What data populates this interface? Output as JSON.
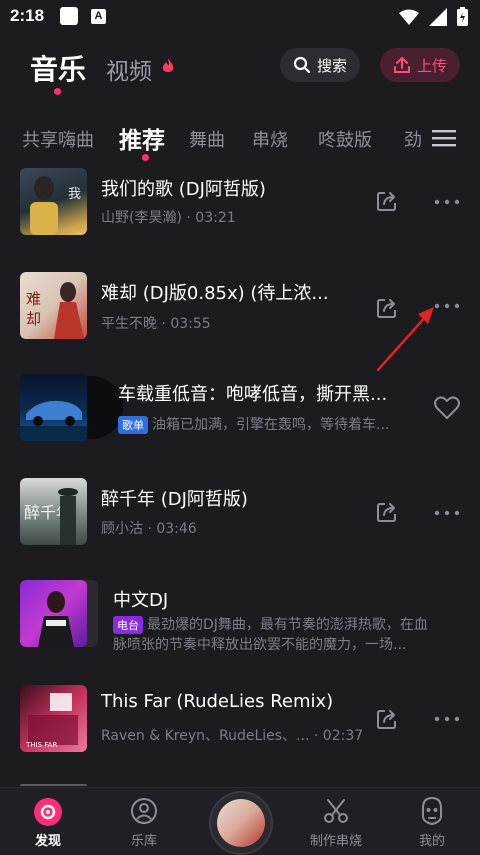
{
  "status": {
    "time": "2:18"
  },
  "header": {
    "tab_music": "音乐",
    "tab_video": "视频",
    "search_label": "搜索",
    "upload_label": "上传"
  },
  "categories": [
    "共享嗨曲",
    "推荐",
    "舞曲",
    "串烧",
    "咚鼓版",
    "劲"
  ],
  "songs": [
    {
      "title": "我们的歌 (DJ阿哲版)",
      "artist": "山野(李昊瀚)",
      "duration": "03:21"
    },
    {
      "title": "难却 (DJ版0.85x) (待上浓...",
      "artist": "平生不晚",
      "duration": "03:55"
    },
    {
      "title": "车载重低音：咆哮低音，撕开黑...",
      "badge": "歌单",
      "desc": "油箱已加满，引擎在轰鸣，等待着车..."
    },
    {
      "title": "醉千年 (DJ阿哲版)",
      "artist": "顾小沽",
      "duration": "03:46"
    },
    {
      "title": "中文DJ",
      "badge": "电台",
      "desc1": "最劲爆的DJ舞曲，最有节奏的澎湃热歌，在血",
      "desc2": "脉喷张的节奏中释放出欲罢不能的魔力，一场..."
    },
    {
      "title": "This Far (RudeLies Remix)",
      "artist": "Raven & Kreyn、RudeLies、...",
      "duration": "02:37"
    }
  ],
  "bottom_nav": {
    "discover": "发现",
    "library": "乐库",
    "make_medley": "制作串烧",
    "mine": "我的"
  },
  "colors": {
    "accent": "#ff2d78",
    "background": "#1b1b20",
    "annotation_arrow": "#e02424"
  }
}
